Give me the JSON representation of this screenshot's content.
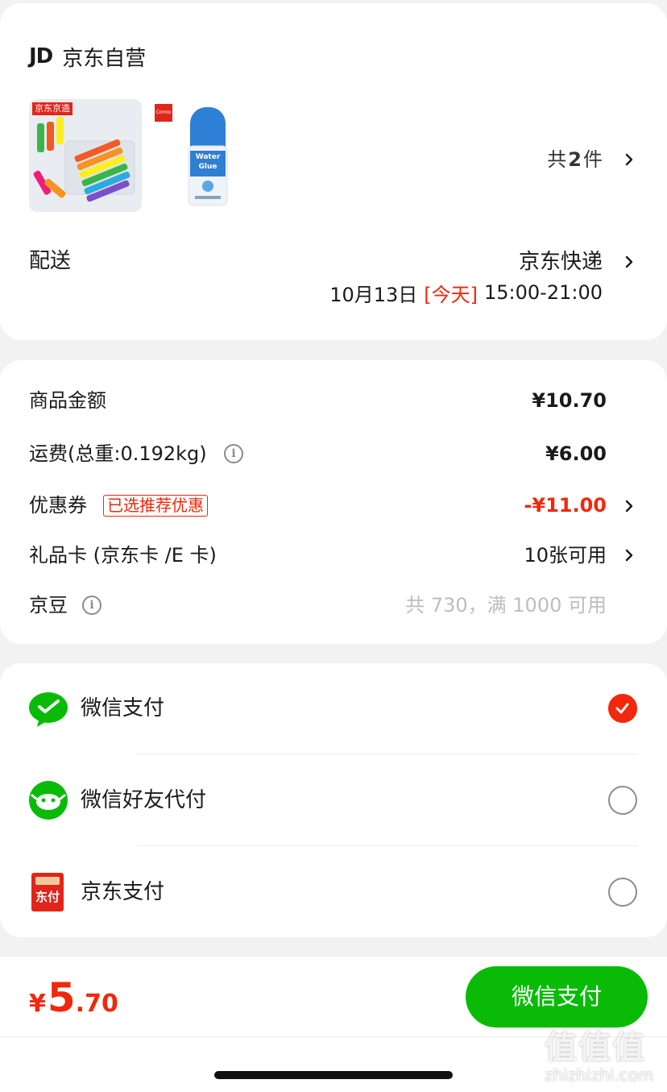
{
  "shop": {
    "logo": "JD",
    "name": "京东自营"
  },
  "products": {
    "thumb1": {
      "tag": "京东京造"
    },
    "thumb2": {
      "brand": "Comix",
      "label_line1": "Water",
      "label_line2": "Glue"
    },
    "count_prefix": "共",
    "count": "2",
    "count_suffix": "件"
  },
  "delivery": {
    "label": "配送",
    "method": "京东快递",
    "date": "10月13日",
    "today": "[今天]",
    "time": "15:00-21:00"
  },
  "summary": {
    "goods_label": "商品金额",
    "goods_value": "¥10.70",
    "shipping_label": "运费(总重:0.192kg)",
    "shipping_value": "¥6.00",
    "coupon_label": "优惠券",
    "coupon_tag": "已选推荐优惠",
    "coupon_value": "-¥11.00",
    "giftcard_label": "礼品卡 (京东卡 /E 卡)",
    "giftcard_value": "10张可用",
    "jingdou_label": "京豆",
    "jingdou_value": "共 730，满 1000 可用"
  },
  "payment": {
    "methods": [
      {
        "label": "微信支付",
        "selected": true
      },
      {
        "label": "微信好友代付",
        "selected": false
      },
      {
        "label": "京东支付",
        "selected": false
      }
    ],
    "jdpay_icon_text": "东付"
  },
  "footer": {
    "currency": "¥",
    "price_int": "5",
    "price_dec": ".70",
    "pay_button": "微信支付"
  },
  "watermark": {
    "glyphs": "值值值",
    "domain": "zhizhizhi.com"
  },
  "colors": {
    "accent_red": "#f2270c",
    "wechat_green": "#07c160",
    "pay_green": "#09bb07"
  }
}
